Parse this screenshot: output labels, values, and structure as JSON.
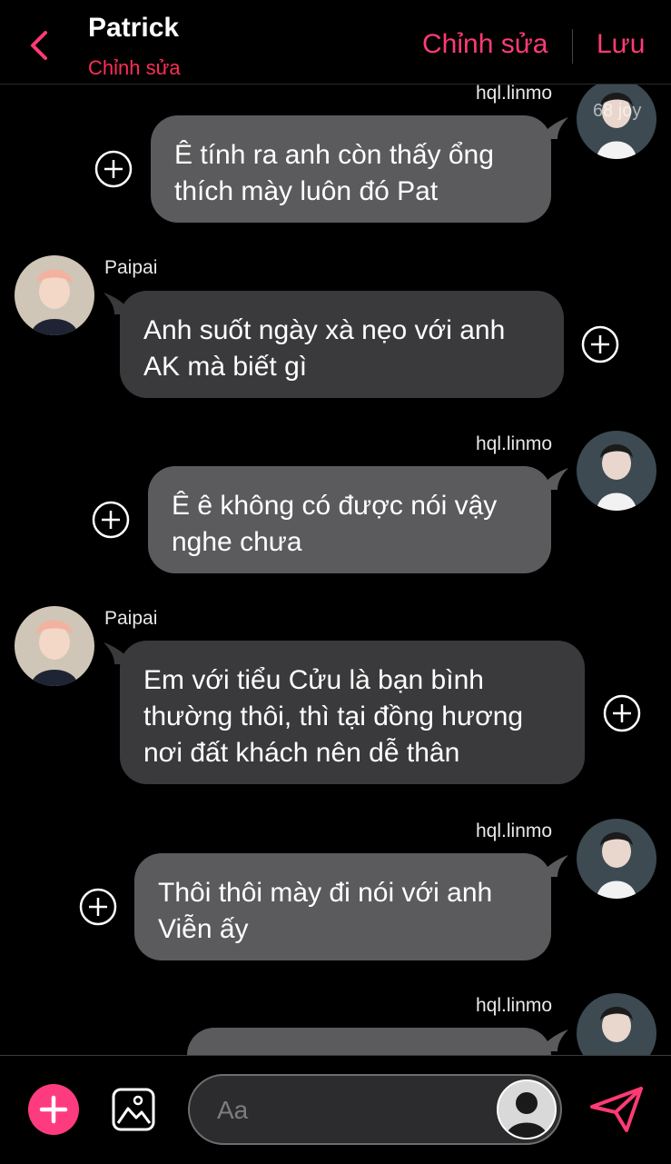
{
  "header": {
    "title": "Patrick",
    "subtitle": "Chỉnh sửa",
    "edit_label": "Chỉnh sửa",
    "save_label": "Lưu"
  },
  "messages": [
    {
      "sender": "hql.linmo",
      "direction": "outgoing",
      "lines": [
        "Ê tính ra anh còn thấy ổng",
        "thích mày luôn đó Pat"
      ],
      "avatar_watermark": "68 joy"
    },
    {
      "sender": "Paipai",
      "direction": "incoming",
      "lines": [
        "Anh suốt ngày xà nẹo với anh",
        "AK mà biết gì"
      ]
    },
    {
      "sender": "hql.linmo",
      "direction": "outgoing",
      "lines": [
        "Ê ê không có được nói vậy",
        "nghe chưa"
      ]
    },
    {
      "sender": "Paipai",
      "direction": "incoming",
      "lines": [
        "Em với tiểu Cửu là bạn bình",
        "thường thôi, thì tại đồng hương",
        "nơi đất khách nên dễ thân"
      ]
    },
    {
      "sender": "hql.linmo",
      "direction": "outgoing",
      "lines": [
        "Thôi thôi mày đi nói với anh",
        "Viễn ấy"
      ]
    },
    {
      "sender": "hql.linmo",
      "direction": "outgoing",
      "lines": [
        ""
      ]
    }
  ],
  "composer": {
    "placeholder": "Aa",
    "add_icon": "plus-icon",
    "gallery_icon": "image-icon",
    "send_icon": "send-icon"
  },
  "colors": {
    "accent": "#ff3b74",
    "outgoing_bubble": "#5b5b5d",
    "incoming_bubble": "#3a3a3c",
    "background": "#000000"
  }
}
